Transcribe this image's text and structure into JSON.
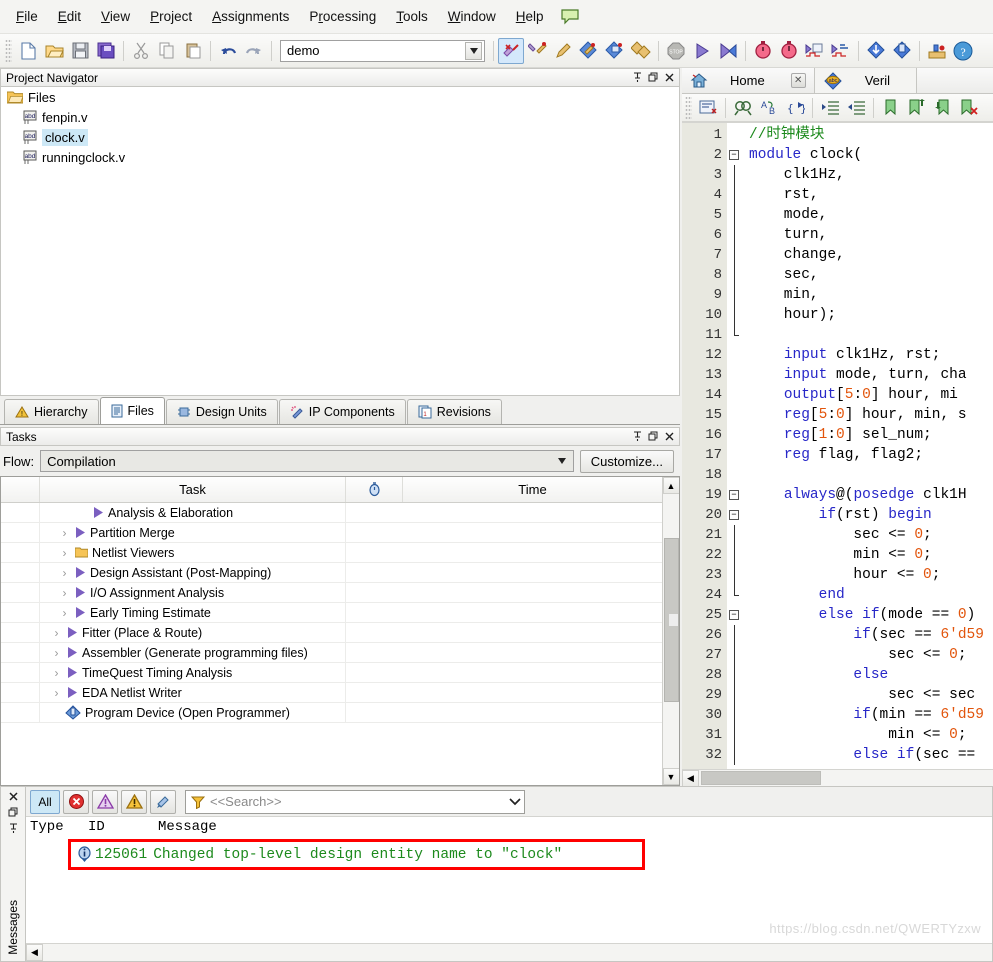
{
  "app": {
    "title": "Quartus II"
  },
  "menubar": {
    "items": [
      {
        "label": "File",
        "accel": "F"
      },
      {
        "label": "Edit",
        "accel": "E"
      },
      {
        "label": "View",
        "accel": "V"
      },
      {
        "label": "Project",
        "accel": "P"
      },
      {
        "label": "Assignments",
        "accel": "A"
      },
      {
        "label": "Processing",
        "accel": "r"
      },
      {
        "label": "Tools",
        "accel": "T"
      },
      {
        "label": "Window",
        "accel": "W"
      },
      {
        "label": "Help",
        "accel": "H"
      }
    ],
    "balloon_icon": "speech-balloon-icon"
  },
  "toolbar": {
    "project_combo_value": "demo",
    "icons": [
      "new-file-icon",
      "open-file-icon",
      "save-icon",
      "save-all-icon",
      "cut-icon",
      "copy-icon",
      "paste-icon",
      "undo-icon",
      "redo-icon",
      "stop-compilation-icon",
      "analysis-synthesis-icon",
      "pin-planner-icon",
      "compile-design-icon",
      "start-compilation-icon",
      "programmer-icon",
      "stop-icon",
      "start-icon",
      "start-analysis-icon",
      "timing-analyzer-icon",
      "timequest-icon",
      "signaltap-icon",
      "in-system-sources-icon",
      "download-icon",
      "program-device-icon",
      "assignment-editor-icon",
      "help-icon"
    ]
  },
  "project_navigator": {
    "title": "Project Navigator",
    "panel_buttons": [
      "pin-icon",
      "restore-icon",
      "close-icon"
    ],
    "root": {
      "label": "Files",
      "icon": "folder-icon"
    },
    "files": [
      {
        "label": "fenpin.v",
        "icon": "verilog-file-icon",
        "selected": false
      },
      {
        "label": "clock.v",
        "icon": "verilog-file-icon",
        "selected": true
      },
      {
        "label": "runningclock.v",
        "icon": "verilog-file-icon",
        "selected": false
      }
    ],
    "tabs": [
      {
        "label": "Hierarchy",
        "icon": "hierarchy-icon",
        "selected": false
      },
      {
        "label": "Files",
        "icon": "files-icon",
        "selected": true
      },
      {
        "label": "Design Units",
        "icon": "design-units-icon",
        "selected": false
      },
      {
        "label": "IP Components",
        "icon": "ip-components-icon",
        "selected": false
      },
      {
        "label": "Revisions",
        "icon": "revisions-icon",
        "selected": false
      }
    ]
  },
  "tasks": {
    "title": "Tasks",
    "panel_buttons": [
      "pin-icon",
      "restore-icon",
      "close-icon"
    ],
    "flow_label": "Flow:",
    "flow_value": "Compilation",
    "customize_label": "Customize...",
    "columns": [
      "",
      "Task",
      "clock-icon",
      "Time"
    ],
    "rows": [
      {
        "label": "Analysis & Elaboration",
        "icon": "run-arrow-icon",
        "indent": 1,
        "expandable": false,
        "time": ""
      },
      {
        "label": "Partition Merge",
        "icon": "run-arrow-icon",
        "indent": 1,
        "expandable": true,
        "time": ""
      },
      {
        "label": "Netlist Viewers",
        "icon": "folder-icon",
        "indent": 1,
        "expandable": true,
        "time": ""
      },
      {
        "label": "Design Assistant (Post-Mapping)",
        "icon": "run-arrow-icon",
        "indent": 1,
        "expandable": true,
        "time": ""
      },
      {
        "label": "I/O Assignment Analysis",
        "icon": "run-arrow-icon",
        "indent": 1,
        "expandable": true,
        "time": ""
      },
      {
        "label": "Early Timing Estimate",
        "icon": "run-arrow-icon",
        "indent": 1,
        "expandable": true,
        "time": ""
      },
      {
        "label": "Fitter (Place & Route)",
        "icon": "run-arrow-icon",
        "indent": 0,
        "expandable": true,
        "time": ""
      },
      {
        "label": "Assembler (Generate programming files)",
        "icon": "run-arrow-icon",
        "indent": 0,
        "expandable": true,
        "time": ""
      },
      {
        "label": "TimeQuest Timing Analysis",
        "icon": "run-arrow-icon",
        "indent": 0,
        "expandable": true,
        "time": ""
      },
      {
        "label": "EDA Netlist Writer",
        "icon": "run-arrow-icon",
        "indent": 0,
        "expandable": true,
        "time": ""
      },
      {
        "label": "Program Device (Open Programmer)",
        "icon": "program-device-icon",
        "indent": 0,
        "expandable": false,
        "time": ""
      }
    ]
  },
  "editor": {
    "tabs": [
      {
        "label": "Home",
        "icon": "home-icon",
        "closable": true,
        "selected": false
      },
      {
        "label": "Veril",
        "icon": "verilog-abc-icon",
        "closable": false,
        "selected": true
      }
    ],
    "toolbar_icons": [
      "insert-template-icon",
      "find-icon",
      "replace-icon",
      "goto-icon",
      "increase-indent-icon",
      "decrease-indent-icon",
      "bookmark-icon",
      "next-bookmark-icon",
      "prev-bookmark-icon",
      "clear-bookmarks-icon"
    ],
    "lines": [
      {
        "n": 1,
        "fold": "none",
        "tokens": [
          {
            "t": "//时钟模块",
            "c": "cmt"
          }
        ]
      },
      {
        "n": 2,
        "fold": "minus",
        "tokens": [
          {
            "t": "module ",
            "c": "kw"
          },
          {
            "t": "clock(",
            "c": ""
          }
        ]
      },
      {
        "n": 3,
        "fold": "bar",
        "tokens": [
          {
            "t": "    clk1Hz,",
            "c": ""
          }
        ]
      },
      {
        "n": 4,
        "fold": "bar",
        "tokens": [
          {
            "t": "    rst,",
            "c": ""
          }
        ]
      },
      {
        "n": 5,
        "fold": "bar",
        "tokens": [
          {
            "t": "    mode,",
            "c": ""
          }
        ]
      },
      {
        "n": 6,
        "fold": "bar",
        "tokens": [
          {
            "t": "    turn,",
            "c": ""
          }
        ]
      },
      {
        "n": 7,
        "fold": "bar",
        "tokens": [
          {
            "t": "    change,",
            "c": ""
          }
        ]
      },
      {
        "n": 8,
        "fold": "bar",
        "tokens": [
          {
            "t": "    sec,",
            "c": ""
          }
        ]
      },
      {
        "n": 9,
        "fold": "bar",
        "tokens": [
          {
            "t": "    min,",
            "c": ""
          }
        ]
      },
      {
        "n": 10,
        "fold": "bar",
        "tokens": [
          {
            "t": "    hour);",
            "c": ""
          }
        ]
      },
      {
        "n": 11,
        "fold": "barend",
        "tokens": [
          {
            "t": "",
            "c": ""
          }
        ]
      },
      {
        "n": 12,
        "fold": "none",
        "tokens": [
          {
            "t": "    ",
            "c": ""
          },
          {
            "t": "input ",
            "c": "kw"
          },
          {
            "t": "clk1Hz, rst;",
            "c": ""
          }
        ]
      },
      {
        "n": 13,
        "fold": "none",
        "tokens": [
          {
            "t": "    ",
            "c": ""
          },
          {
            "t": "input ",
            "c": "kw"
          },
          {
            "t": "mode, turn, cha",
            "c": ""
          }
        ]
      },
      {
        "n": 14,
        "fold": "none",
        "tokens": [
          {
            "t": "    ",
            "c": ""
          },
          {
            "t": "output",
            "c": "kw"
          },
          {
            "t": "[",
            "c": ""
          },
          {
            "t": "5",
            "c": "num"
          },
          {
            "t": ":",
            "c": ""
          },
          {
            "t": "0",
            "c": "num"
          },
          {
            "t": "] hour, mi",
            "c": ""
          }
        ]
      },
      {
        "n": 15,
        "fold": "none",
        "tokens": [
          {
            "t": "    ",
            "c": ""
          },
          {
            "t": "reg",
            "c": "kw"
          },
          {
            "t": "[",
            "c": ""
          },
          {
            "t": "5",
            "c": "num"
          },
          {
            "t": ":",
            "c": ""
          },
          {
            "t": "0",
            "c": "num"
          },
          {
            "t": "] hour, min, s",
            "c": ""
          }
        ]
      },
      {
        "n": 16,
        "fold": "none",
        "tokens": [
          {
            "t": "    ",
            "c": ""
          },
          {
            "t": "reg",
            "c": "kw"
          },
          {
            "t": "[",
            "c": ""
          },
          {
            "t": "1",
            "c": "num"
          },
          {
            "t": ":",
            "c": ""
          },
          {
            "t": "0",
            "c": "num"
          },
          {
            "t": "] sel_num;",
            "c": ""
          }
        ]
      },
      {
        "n": 17,
        "fold": "none",
        "tokens": [
          {
            "t": "    ",
            "c": ""
          },
          {
            "t": "reg ",
            "c": "kw"
          },
          {
            "t": "flag, flag2;",
            "c": ""
          }
        ]
      },
      {
        "n": 18,
        "fold": "none",
        "tokens": [
          {
            "t": "",
            "c": ""
          }
        ]
      },
      {
        "n": 19,
        "fold": "minus",
        "tokens": [
          {
            "t": "    ",
            "c": ""
          },
          {
            "t": "always",
            "c": "kw"
          },
          {
            "t": "@(",
            "c": ""
          },
          {
            "t": "posedge ",
            "c": "kw"
          },
          {
            "t": "clk1H",
            "c": ""
          }
        ]
      },
      {
        "n": 20,
        "fold": "minus",
        "tokens": [
          {
            "t": "        ",
            "c": ""
          },
          {
            "t": "if",
            "c": "kw"
          },
          {
            "t": "(rst) ",
            "c": ""
          },
          {
            "t": "begin",
            "c": "kw"
          }
        ]
      },
      {
        "n": 21,
        "fold": "bar",
        "tokens": [
          {
            "t": "            sec <= ",
            "c": ""
          },
          {
            "t": "0",
            "c": "num"
          },
          {
            "t": ";",
            "c": ""
          }
        ]
      },
      {
        "n": 22,
        "fold": "bar",
        "tokens": [
          {
            "t": "            min <= ",
            "c": ""
          },
          {
            "t": "0",
            "c": "num"
          },
          {
            "t": ";",
            "c": ""
          }
        ]
      },
      {
        "n": 23,
        "fold": "bar",
        "tokens": [
          {
            "t": "            hour <= ",
            "c": ""
          },
          {
            "t": "0",
            "c": "num"
          },
          {
            "t": ";",
            "c": ""
          }
        ]
      },
      {
        "n": 24,
        "fold": "barend",
        "tokens": [
          {
            "t": "        ",
            "c": ""
          },
          {
            "t": "end",
            "c": "kw"
          }
        ]
      },
      {
        "n": 25,
        "fold": "minus",
        "tokens": [
          {
            "t": "        ",
            "c": ""
          },
          {
            "t": "else if",
            "c": "kw"
          },
          {
            "t": "(mode == ",
            "c": ""
          },
          {
            "t": "0",
            "c": "num"
          },
          {
            "t": ")",
            "c": ""
          }
        ]
      },
      {
        "n": 26,
        "fold": "bar",
        "tokens": [
          {
            "t": "            ",
            "c": ""
          },
          {
            "t": "if",
            "c": "kw"
          },
          {
            "t": "(sec == ",
            "c": ""
          },
          {
            "t": "6'd59",
            "c": "num"
          }
        ]
      },
      {
        "n": 27,
        "fold": "bar",
        "tokens": [
          {
            "t": "                sec <= ",
            "c": ""
          },
          {
            "t": "0",
            "c": "num"
          },
          {
            "t": ";",
            "c": ""
          }
        ]
      },
      {
        "n": 28,
        "fold": "bar",
        "tokens": [
          {
            "t": "            ",
            "c": ""
          },
          {
            "t": "else",
            "c": "kw"
          }
        ]
      },
      {
        "n": 29,
        "fold": "bar",
        "tokens": [
          {
            "t": "                sec <= sec ",
            "c": ""
          }
        ]
      },
      {
        "n": 30,
        "fold": "bar",
        "tokens": [
          {
            "t": "            ",
            "c": ""
          },
          {
            "t": "if",
            "c": "kw"
          },
          {
            "t": "(min == ",
            "c": ""
          },
          {
            "t": "6'd59",
            "c": "num"
          }
        ]
      },
      {
        "n": 31,
        "fold": "bar",
        "tokens": [
          {
            "t": "                min <= ",
            "c": ""
          },
          {
            "t": "0",
            "c": "num"
          },
          {
            "t": ";",
            "c": ""
          }
        ]
      },
      {
        "n": 32,
        "fold": "bar",
        "tokens": [
          {
            "t": "            ",
            "c": ""
          },
          {
            "t": "else if",
            "c": "kw"
          },
          {
            "t": "(sec ==",
            "c": ""
          }
        ]
      }
    ]
  },
  "messages": {
    "vertical_label": "Messages",
    "sidebar_buttons": [
      "close-icon",
      "restore-icon",
      "pin-icon"
    ],
    "filter_buttons": [
      {
        "label": "All",
        "name": "filter-all",
        "active": true
      },
      {
        "label": "",
        "name": "filter-error-icon",
        "active": false
      },
      {
        "label": "",
        "name": "filter-critical-warning-icon",
        "active": false
      },
      {
        "label": "",
        "name": "filter-warning-icon",
        "active": false
      },
      {
        "label": "",
        "name": "filter-info-icon",
        "active": false
      }
    ],
    "search_placeholder": "<<Search>>",
    "columns": [
      "Type",
      "ID",
      "Message"
    ],
    "rows": [
      {
        "icon": "info-icon",
        "id": "125061",
        "text": "Changed top-level design entity name to \"clock\"",
        "highlighted": true
      }
    ]
  },
  "watermark": "https://blog.csdn.net/QWERTYzxw",
  "colors": {
    "accent": "#2727c8",
    "comment_green": "#1d8a1d",
    "number_orange": "#e2550c",
    "highlight_red": "#ff0000",
    "selection_blue": "#cde8f6"
  }
}
